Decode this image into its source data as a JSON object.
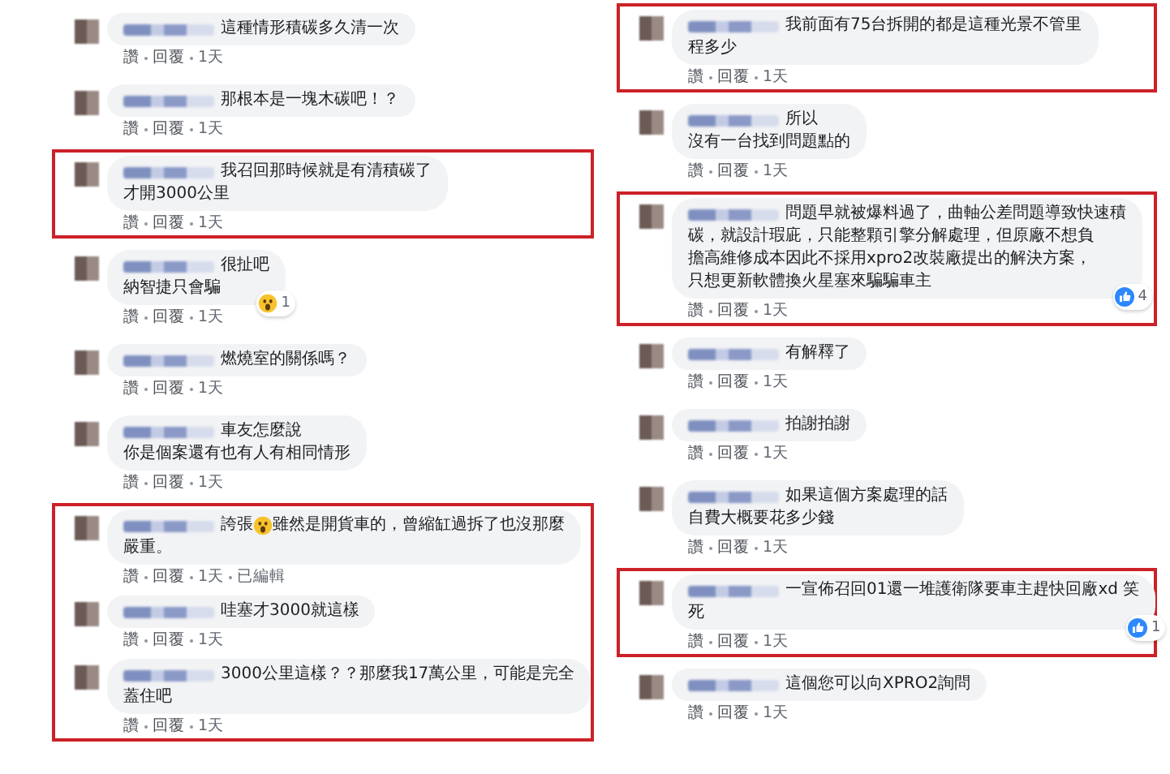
{
  "columns": [
    {
      "groups": [
        {
          "highlighted": false,
          "comments": [
            {
              "lines": [
                "這種情形積碳多久清一次"
              ],
              "meta": [
                {
                  "kind": "link",
                  "text": "讚"
                },
                {
                  "kind": "link",
                  "text": "回覆"
                },
                {
                  "kind": "time",
                  "text": "1天"
                }
              ]
            }
          ]
        },
        {
          "highlighted": false,
          "comments": [
            {
              "lines": [
                "那根本是一塊木碳吧！？"
              ],
              "meta": [
                {
                  "kind": "link",
                  "text": "讚"
                },
                {
                  "kind": "link",
                  "text": "回覆"
                },
                {
                  "kind": "time",
                  "text": "1天"
                }
              ]
            }
          ]
        },
        {
          "highlighted": true,
          "comments": [
            {
              "lines": [
                "我召回那時候就是有清積碳了",
                "才開3000公里"
              ],
              "meta": [
                {
                  "kind": "link",
                  "text": "讚"
                },
                {
                  "kind": "link",
                  "text": "回覆"
                },
                {
                  "kind": "time",
                  "text": "1天"
                }
              ]
            }
          ]
        },
        {
          "highlighted": false,
          "comments": [
            {
              "lines": [
                "很扯吧",
                "納智捷只會騙"
              ],
              "reaction": {
                "kind": "wow",
                "count": "1"
              },
              "meta": [
                {
                  "kind": "link",
                  "text": "讚"
                },
                {
                  "kind": "link",
                  "text": "回覆"
                },
                {
                  "kind": "time",
                  "text": "1天"
                }
              ]
            }
          ]
        },
        {
          "highlighted": false,
          "comments": [
            {
              "lines": [
                "燃燒室的關係嗎？"
              ],
              "meta": [
                {
                  "kind": "link",
                  "text": "讚"
                },
                {
                  "kind": "link",
                  "text": "回覆"
                },
                {
                  "kind": "time",
                  "text": "1天"
                }
              ]
            }
          ]
        },
        {
          "highlighted": false,
          "comments": [
            {
              "lines": [
                "車友怎麼說",
                "你是個案還有也有人有相同情形"
              ],
              "meta": [
                {
                  "kind": "link",
                  "text": "讚"
                },
                {
                  "kind": "link",
                  "text": "回覆"
                },
                {
                  "kind": "time",
                  "text": "1天"
                }
              ]
            }
          ]
        },
        {
          "highlighted": true,
          "comments": [
            {
              "text_before": "誇張",
              "emoji": {
                "kind": "scream"
              },
              "lines": [
                "雖然是開貨車的，曾縮缸過拆了也沒那麼",
                "嚴重。"
              ],
              "meta": [
                {
                  "kind": "link",
                  "text": "讚"
                },
                {
                  "kind": "link",
                  "text": "回覆"
                },
                {
                  "kind": "time",
                  "text": "1天"
                },
                {
                  "kind": "note",
                  "text": "已編輯"
                }
              ]
            },
            {
              "lines": [
                "哇塞才3000就這樣"
              ],
              "meta": [
                {
                  "kind": "link",
                  "text": "讚"
                },
                {
                  "kind": "link",
                  "text": "回覆"
                },
                {
                  "kind": "time",
                  "text": "1天"
                }
              ]
            },
            {
              "lines": [
                "3000公里這樣？？那麼我17萬公里，可能是完全",
                "蓋住吧"
              ],
              "meta": [
                {
                  "kind": "link",
                  "text": "讚"
                },
                {
                  "kind": "link",
                  "text": "回覆"
                },
                {
                  "kind": "time",
                  "text": "1天"
                }
              ]
            }
          ]
        }
      ]
    },
    {
      "groups": [
        {
          "highlighted": true,
          "comments": [
            {
              "lines": [
                "我前面有75台拆開的都是這種光景不管里",
                "程多少"
              ],
              "meta": [
                {
                  "kind": "link",
                  "text": "讚"
                },
                {
                  "kind": "link",
                  "text": "回覆"
                },
                {
                  "kind": "time",
                  "text": "1天"
                }
              ]
            }
          ]
        },
        {
          "highlighted": false,
          "comments": [
            {
              "lines": [
                "所以",
                "沒有一台找到問題點的"
              ],
              "meta": [
                {
                  "kind": "link",
                  "text": "讚"
                },
                {
                  "kind": "link",
                  "text": "回覆"
                },
                {
                  "kind": "time",
                  "text": "1天"
                }
              ]
            }
          ]
        },
        {
          "highlighted": true,
          "comments": [
            {
              "lines": [
                "問題早就被爆料過了，曲軸公差問題導致快速積",
                "碳，就設計瑕庛，只能整顆引擎分解處理，但原廠不想負",
                "擔高維修成本因此不採用xpro2改裝廠提出的解決方案，",
                "只想更新軟體換火星塞來騙騙車主"
              ],
              "reaction": {
                "kind": "like",
                "count": "4"
              },
              "meta": [
                {
                  "kind": "link",
                  "text": "讚"
                },
                {
                  "kind": "link",
                  "text": "回覆"
                },
                {
                  "kind": "time",
                  "text": "1天"
                }
              ]
            }
          ]
        },
        {
          "highlighted": false,
          "comments": [
            {
              "lines": [
                "有解釋了"
              ],
              "meta": [
                {
                  "kind": "link",
                  "text": "讚"
                },
                {
                  "kind": "link",
                  "text": "回覆"
                },
                {
                  "kind": "time",
                  "text": "1天"
                }
              ]
            }
          ]
        },
        {
          "highlighted": false,
          "comments": [
            {
              "lines": [
                "拍謝拍謝"
              ],
              "meta": [
                {
                  "kind": "link",
                  "text": "讚"
                },
                {
                  "kind": "link",
                  "text": "回覆"
                },
                {
                  "kind": "time",
                  "text": "1天"
                }
              ]
            }
          ]
        },
        {
          "highlighted": false,
          "comments": [
            {
              "lines": [
                "如果這個方案處理的話",
                "自費大概要花多少錢"
              ],
              "meta": [
                {
                  "kind": "link",
                  "text": "讚"
                },
                {
                  "kind": "link",
                  "text": "回覆"
                },
                {
                  "kind": "time",
                  "text": "1天"
                }
              ]
            }
          ]
        },
        {
          "highlighted": true,
          "comments": [
            {
              "lines": [
                "一宣佈召回01還一堆護衛隊要車主趕快回廠xd 笑",
                "死"
              ],
              "reaction": {
                "kind": "like",
                "count": "1"
              },
              "meta": [
                {
                  "kind": "link",
                  "text": "讚"
                },
                {
                  "kind": "link",
                  "text": "回覆"
                },
                {
                  "kind": "time",
                  "text": "1天"
                }
              ]
            }
          ]
        },
        {
          "highlighted": false,
          "comments": [
            {
              "lines": [
                "這個您可以向XPRO2詢問"
              ],
              "meta": [
                {
                  "kind": "link",
                  "text": "讚"
                },
                {
                  "kind": "link",
                  "text": "回覆"
                },
                {
                  "kind": "time",
                  "text": "1天"
                }
              ]
            }
          ]
        }
      ]
    }
  ]
}
